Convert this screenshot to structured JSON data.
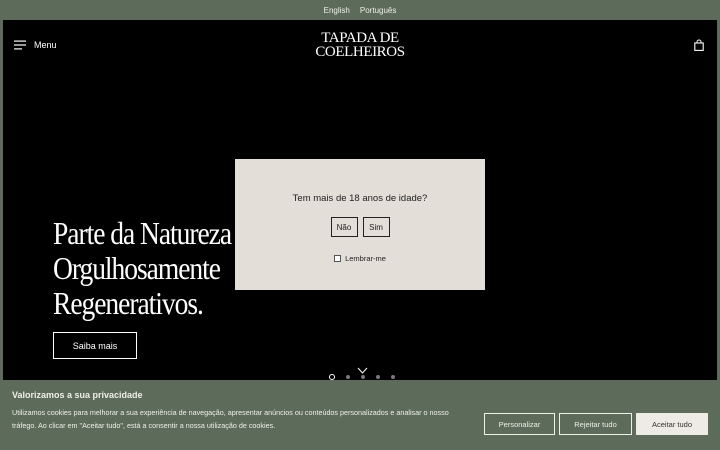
{
  "languages": [
    "English",
    "Português"
  ],
  "header": {
    "menu_label": "Menu",
    "logo_line1": "TAPADA DE",
    "logo_line2": "COELHEIROS"
  },
  "hero": {
    "title_lines": [
      "Parte da Natureza",
      "Orgulhosamente",
      "Regenerativos."
    ],
    "cta_label": "Saiba mais",
    "slides_count": 5,
    "active_slide": 1
  },
  "age_gate": {
    "question": "Tem mais de 18 anos de idade?",
    "no_label": "Não",
    "yes_label": "Sim",
    "remember_label": "Lembrar-me",
    "remember_checked": false
  },
  "cookie_banner": {
    "title": "Valorizamos a sua privacidade",
    "text": "Utilizamos cookies para melhorar a sua experiência de navegação, apresentar anúncios ou conteúdos personalizados e analisar o nosso tráfego. Ao clicar em \"Aceitar tudo\", está a consentir a nossa utilização de cookies.",
    "customize_label": "Personalizar",
    "reject_label": "Rejeitar tudo",
    "accept_label": "Aceitar tudo"
  },
  "colors": {
    "banner_green": "#5d6b5a",
    "modal_bg": "#e3ded8",
    "hero_bg": "#000000"
  }
}
